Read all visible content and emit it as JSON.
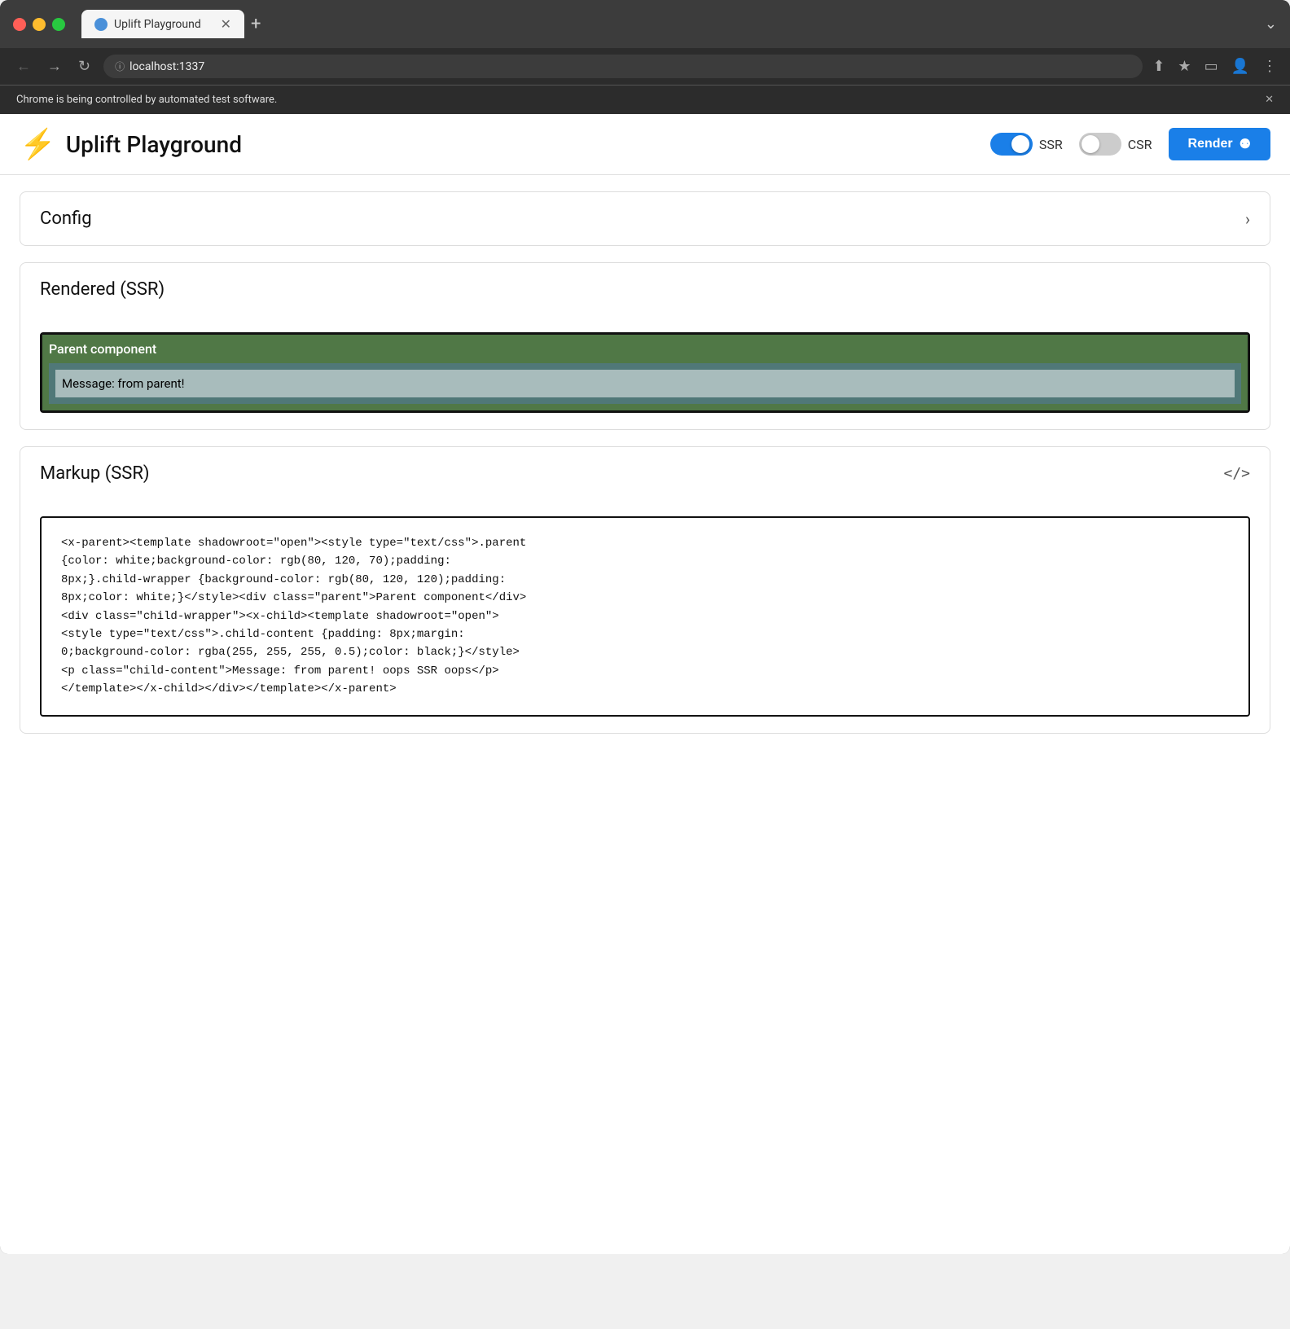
{
  "browser": {
    "tab_title": "Uplift Playground",
    "url": "localhost:1337",
    "automation_banner": "Chrome is being controlled by automated test software.",
    "close_label": "✕",
    "new_tab_label": "+",
    "overflow_label": "⌄"
  },
  "app": {
    "title": "Uplift Playground",
    "ssr_label": "SSR",
    "csr_label": "CSR",
    "render_button_label": "Render",
    "ssr_enabled": true,
    "csr_enabled": false
  },
  "config_section": {
    "title": "Config"
  },
  "rendered_section": {
    "title": "Rendered (SSR)",
    "parent_label": "Parent component",
    "child_message": "Message: from parent!"
  },
  "markup_section": {
    "title": "Markup (SSR)",
    "code_icon": "</>",
    "markup_text": "<x-parent><template shadowroot=\"open\"><style type=\"text/css\">.parent\n{color: white;background-color: rgb(80, 120, 70);padding:\n8px;}.child-wrapper {background-color: rgb(80, 120, 120);padding:\n8px;color: white;}</style><div class=\"parent\">Parent component</div>\n<div class=\"child-wrapper\"><x-child><template shadowroot=\"open\">\n<style type=\"text/css\">.child-content {padding: 8px;margin:\n0;background-color: rgba(255, 255, 255, 0.5);color: black;}</style>\n<p class=\"child-content\">Message: from parent! oops SSR oops</p>\n</template></x-child></div></template></x-parent>"
  },
  "icons": {
    "lightning": "⚡",
    "refresh": "↻",
    "back": "←",
    "forward": "→",
    "share": "⬆",
    "bookmark": "☆",
    "sidebar": "▭",
    "profile": "👤",
    "more": "⋮"
  }
}
